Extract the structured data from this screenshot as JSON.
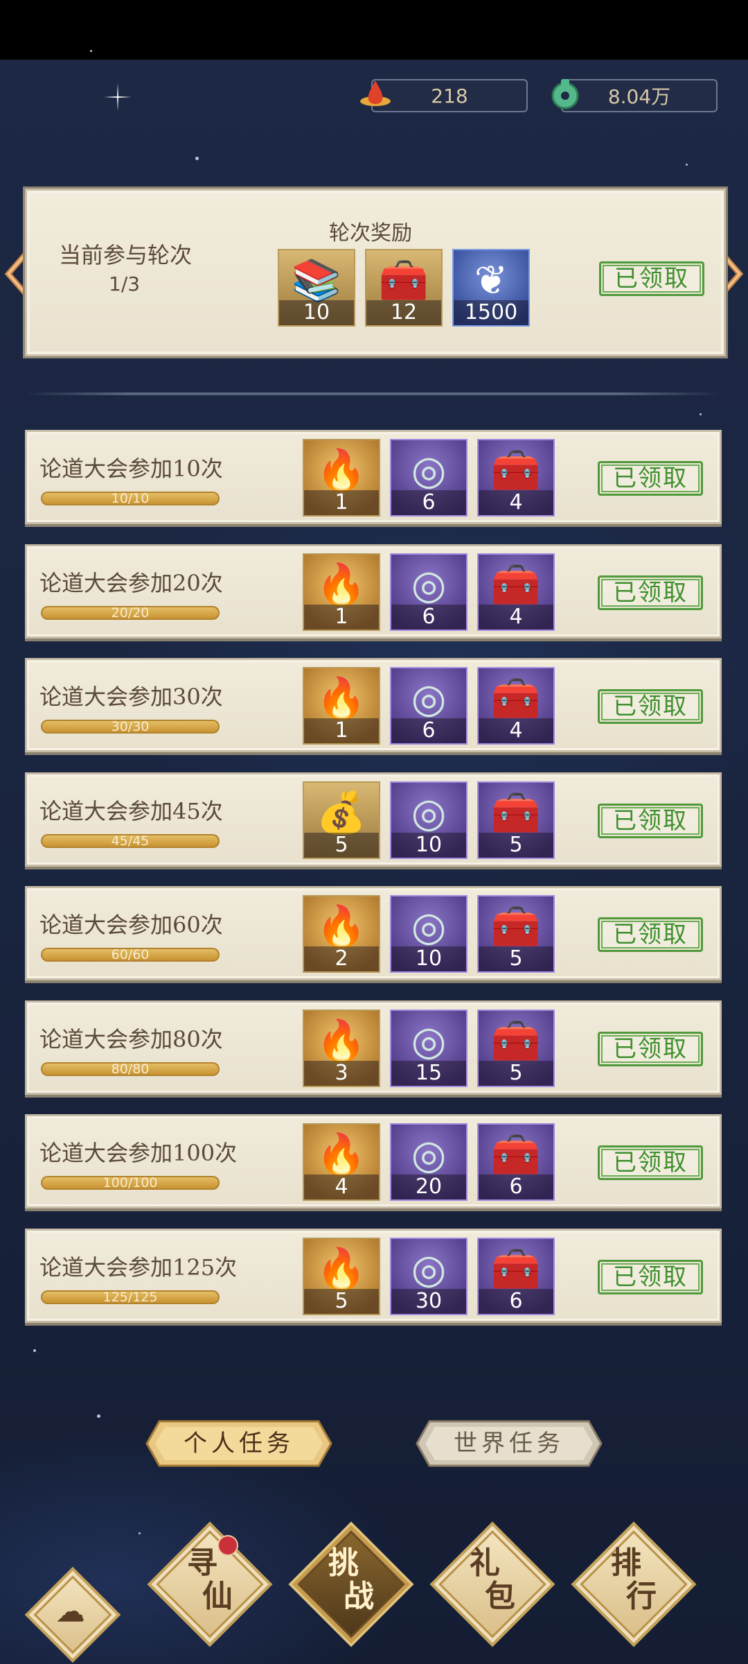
{
  "currency": [
    {
      "icon": "flame-drop-icon",
      "value": "218"
    },
    {
      "icon": "jade-coin-icon",
      "value": "8.04万"
    }
  ],
  "round": {
    "current_label": "当前参与轮次",
    "current_value": "1/3",
    "reward_title": "轮次奖励",
    "rewards": [
      {
        "icon": "scroll-book-icon",
        "count": "10"
      },
      {
        "icon": "treasure-chest-icon",
        "count": "12"
      },
      {
        "icon": "ginkgo-leaf-icon",
        "count": "1500"
      }
    ],
    "status": "已领取"
  },
  "tasks": [
    {
      "name": "论道大会参加10次",
      "progress": "10/10",
      "rewards": [
        {
          "icon": "flame-drop-icon",
          "count": "1"
        },
        {
          "icon": "jade-coin-icon",
          "count": "6"
        },
        {
          "icon": "treasure-chest-icon",
          "count": "4"
        }
      ],
      "status": "已领取"
    },
    {
      "name": "论道大会参加20次",
      "progress": "20/20",
      "rewards": [
        {
          "icon": "flame-drop-icon",
          "count": "1"
        },
        {
          "icon": "jade-coin-icon",
          "count": "6"
        },
        {
          "icon": "treasure-chest-icon",
          "count": "4"
        }
      ],
      "status": "已领取"
    },
    {
      "name": "论道大会参加30次",
      "progress": "30/30",
      "rewards": [
        {
          "icon": "flame-drop-icon",
          "count": "1"
        },
        {
          "icon": "jade-coin-icon",
          "count": "6"
        },
        {
          "icon": "treasure-chest-icon",
          "count": "4"
        }
      ],
      "status": "已领取"
    },
    {
      "name": "论道大会参加45次",
      "progress": "45/45",
      "rewards": [
        {
          "icon": "pouch-icon",
          "count": "5"
        },
        {
          "icon": "jade-coin-icon",
          "count": "10"
        },
        {
          "icon": "treasure-chest-icon",
          "count": "5"
        }
      ],
      "status": "已领取"
    },
    {
      "name": "论道大会参加60次",
      "progress": "60/60",
      "rewards": [
        {
          "icon": "flame-drop-icon",
          "count": "2"
        },
        {
          "icon": "jade-coin-icon",
          "count": "10"
        },
        {
          "icon": "treasure-chest-icon",
          "count": "5"
        }
      ],
      "status": "已领取"
    },
    {
      "name": "论道大会参加80次",
      "progress": "80/80",
      "rewards": [
        {
          "icon": "flame-drop-icon",
          "count": "3"
        },
        {
          "icon": "jade-coin-icon",
          "count": "15"
        },
        {
          "icon": "treasure-chest-icon",
          "count": "5"
        }
      ],
      "status": "已领取"
    },
    {
      "name": "论道大会参加100次",
      "progress": "100/100",
      "rewards": [
        {
          "icon": "flame-drop-icon",
          "count": "4"
        },
        {
          "icon": "jade-coin-icon",
          "count": "20"
        },
        {
          "icon": "treasure-chest-icon",
          "count": "6"
        }
      ],
      "status": "已领取"
    },
    {
      "name": "论道大会参加125次",
      "progress": "125/125",
      "rewards": [
        {
          "icon": "flame-drop-icon",
          "count": "5"
        },
        {
          "icon": "jade-coin-icon",
          "count": "30"
        },
        {
          "icon": "treasure-chest-icon",
          "count": "6"
        }
      ],
      "status": "已领取"
    }
  ],
  "tabs": {
    "personal": "个人任务",
    "world": "世界任务"
  },
  "nav": {
    "home_icon": "cloud-emblem-icon",
    "items": [
      {
        "top": "寻",
        "bottom": "仙"
      },
      {
        "top": "挑",
        "bottom": "战"
      },
      {
        "top": "礼",
        "bottom": "包"
      },
      {
        "top": "排",
        "bottom": "行"
      }
    ]
  },
  "colors": {
    "claimed_green": "#3f8f2f",
    "progress_gold": "#d4a443",
    "panel_bg": "#efe9d8"
  }
}
